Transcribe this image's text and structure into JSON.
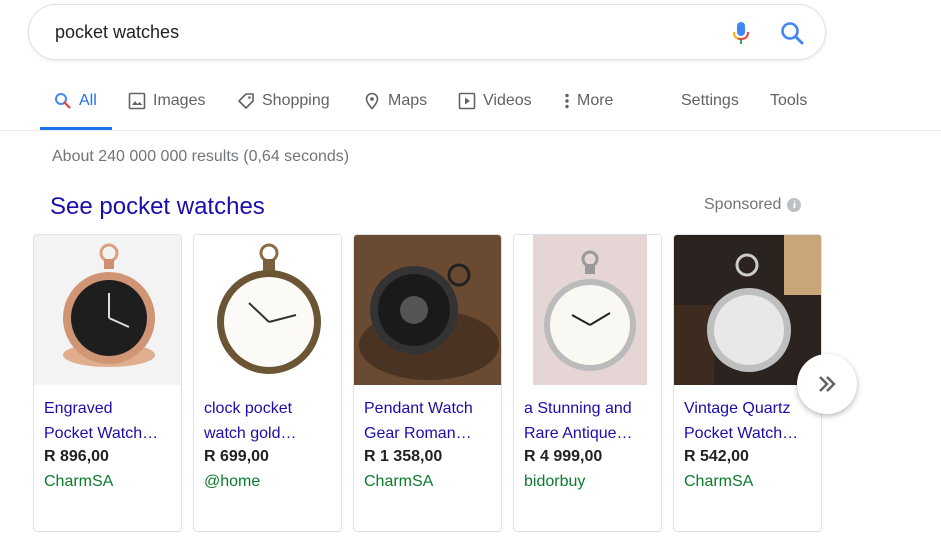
{
  "search": {
    "query": "pocket watches"
  },
  "tabs": [
    {
      "label": "All",
      "icon": "search-icon"
    },
    {
      "label": "Images",
      "icon": "image-icon"
    },
    {
      "label": "Shopping",
      "icon": "tag-icon"
    },
    {
      "label": "Maps",
      "icon": "map-pin-icon"
    },
    {
      "label": "Videos",
      "icon": "video-icon"
    },
    {
      "label": "More",
      "icon": "more-vert-icon"
    }
  ],
  "tools": {
    "settings": "Settings",
    "tools": "Tools"
  },
  "results": {
    "count": "About 240 000 000 results (0,64 seconds)"
  },
  "shopping": {
    "title": "See pocket watches",
    "sponsored": "Sponsored",
    "products": [
      {
        "title_line1": "Engraved",
        "title_line2": "Pocket Watch…",
        "price": "R 896,00",
        "merchant": "CharmSA"
      },
      {
        "title_line1": "clock pocket",
        "title_line2": "watch gold…",
        "price": "R 699,00",
        "merchant": "@home"
      },
      {
        "title_line1": "Pendant Watch",
        "title_line2": "Gear Roman…",
        "price": "R 1 358,00",
        "merchant": "CharmSA"
      },
      {
        "title_line1": "a Stunning and",
        "title_line2": "Rare Antique…",
        "price": "R 4 999,00",
        "merchant": "bidorbuy"
      },
      {
        "title_line1": "Vintage Quartz",
        "title_line2": "Pocket Watch…",
        "price": "R 542,00",
        "merchant": "CharmSA"
      }
    ]
  },
  "colors": {
    "link": "#1a0dab",
    "accent": "#1a73e8",
    "merchant": "#0a7b2c"
  }
}
